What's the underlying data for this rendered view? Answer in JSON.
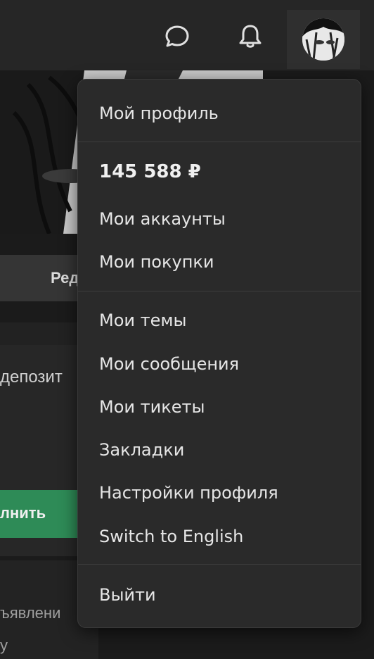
{
  "header": {
    "icons": {
      "messages": "chat-bubble-icon",
      "notifications": "bell-icon",
      "avatar": "user-avatar"
    }
  },
  "background": {
    "edit_label": "Ред",
    "deposit_label": "депозит",
    "topup_label": "лнить",
    "ads_label": "ъявлени",
    "cut_label": "y"
  },
  "dropdown": {
    "profile": "Мой профиль",
    "balance": "145 588 ₽",
    "accounts": "Мои аккаунты",
    "purchases": "Мои покупки",
    "topics": "Мои темы",
    "messages": "Мои сообщения",
    "tickets": "Мои тикеты",
    "bookmarks": "Закладки",
    "settings": "Настройки профиля",
    "language": "Switch to English",
    "logout": "Выйти"
  },
  "colors": {
    "accent_green": "#2e8b57",
    "menu_bg": "#2a2a2a",
    "header_bg": "#262626"
  }
}
